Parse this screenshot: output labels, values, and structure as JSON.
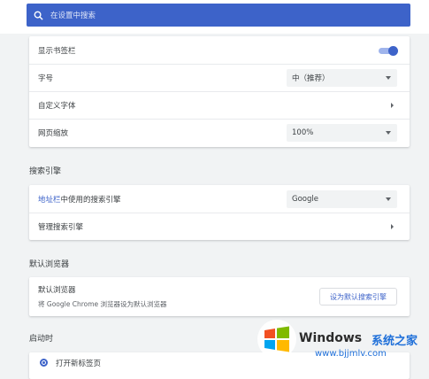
{
  "search": {
    "placeholder": "在设置中搜索"
  },
  "appearance": {
    "bookmarks_bar_label": "显示书签栏",
    "bookmarks_bar_on": true,
    "font_size_label": "字号",
    "font_size_value": "中（推荐）",
    "custom_fonts_label": "自定义字体",
    "zoom_label": "网页缩放",
    "zoom_value": "100%"
  },
  "search_engine": {
    "section_title": "搜索引擎",
    "address_bar_link": "地址栏",
    "address_bar_rest": "中使用的搜索引擎",
    "engine_value": "Google",
    "manage_label": "管理搜索引擎"
  },
  "default_browser": {
    "section_title": "默认浏览器",
    "label": "默认浏览器",
    "subtitle": "将 Google Chrome 浏览器设为默认浏览器",
    "button_label": "设为默认搜索引擎"
  },
  "on_startup": {
    "section_title": "启动时",
    "option_new_tab": "打开新标签页"
  },
  "watermark": {
    "brand": "Windows",
    "cn": "系统之家",
    "url": "www.bjjmlv.com"
  },
  "colors": {
    "accent": "#3d63c9",
    "background": "#f1f3f4"
  }
}
